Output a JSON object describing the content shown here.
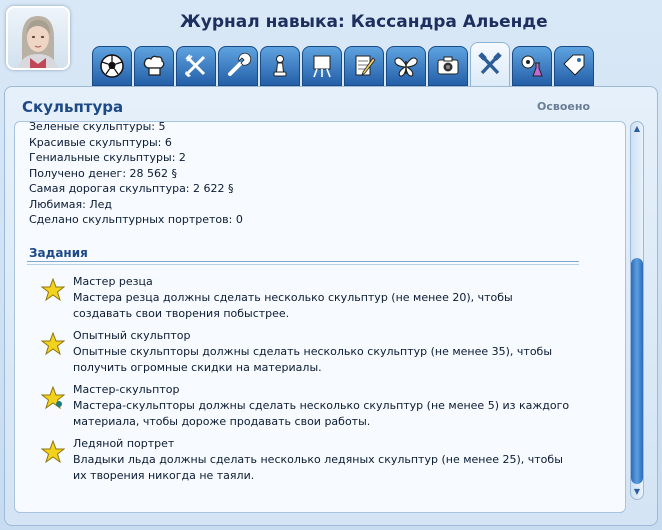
{
  "header": {
    "title": "Журнал навыка: Кассандра Альенде"
  },
  "tabs": [
    {
      "icon": "soccer-ball-icon",
      "active": false
    },
    {
      "icon": "chef-hat-icon",
      "active": false
    },
    {
      "icon": "garden-tools-icon",
      "active": false
    },
    {
      "icon": "wrench-icon",
      "active": false
    },
    {
      "icon": "chess-pawn-icon",
      "active": false
    },
    {
      "icon": "easel-icon",
      "active": false
    },
    {
      "icon": "notepad-pencil-icon",
      "active": false
    },
    {
      "icon": "butterfly-icon",
      "active": false
    },
    {
      "icon": "camera-icon",
      "active": false
    },
    {
      "icon": "sculpting-tools-icon",
      "active": true
    },
    {
      "icon": "gear-flask-icon",
      "active": false
    },
    {
      "icon": "tag-icon",
      "active": false
    }
  ],
  "skill": {
    "name": "Скульптура",
    "status": "Освоено"
  },
  "stats": [
    "Зеленые скульптуры: 5",
    "Красивые скульптуры: 6",
    "Гениальные скульптуры: 2",
    "Получено денег: 28 562 §",
    "Самая дорогая скульптура: 2 622 §",
    "Любимая: Лед",
    "Сделано скульптурных портретов: 0"
  ],
  "challenges": {
    "title": "Задания",
    "items": [
      {
        "name": "Мастер резца",
        "desc": "Мастера резца должны сделать несколько скульптур (не менее 20), чтобы создавать свои творения побыстрее."
      },
      {
        "name": "Опытный скульптор",
        "desc": "Опытные скульпторы  должны сделать несколько скульптур (не менее 35), чтобы получить огромные скидки на материалы."
      },
      {
        "name": "Мастер-скульптор",
        "desc": "Мастера-скульпторы должны сделать несколько скульптур (не менее 5) из каждого материала, чтобы дороже продавать свои работы."
      },
      {
        "name": "Ледяной портрет",
        "desc": "Владыки льда должны сделать несколько ледяных скульптур (не менее 25), чтобы их творения никогда не таяли."
      }
    ]
  },
  "colors": {
    "accent": "#1d4a86",
    "tab": "#2a6cb6",
    "star": "#f3d21c"
  }
}
